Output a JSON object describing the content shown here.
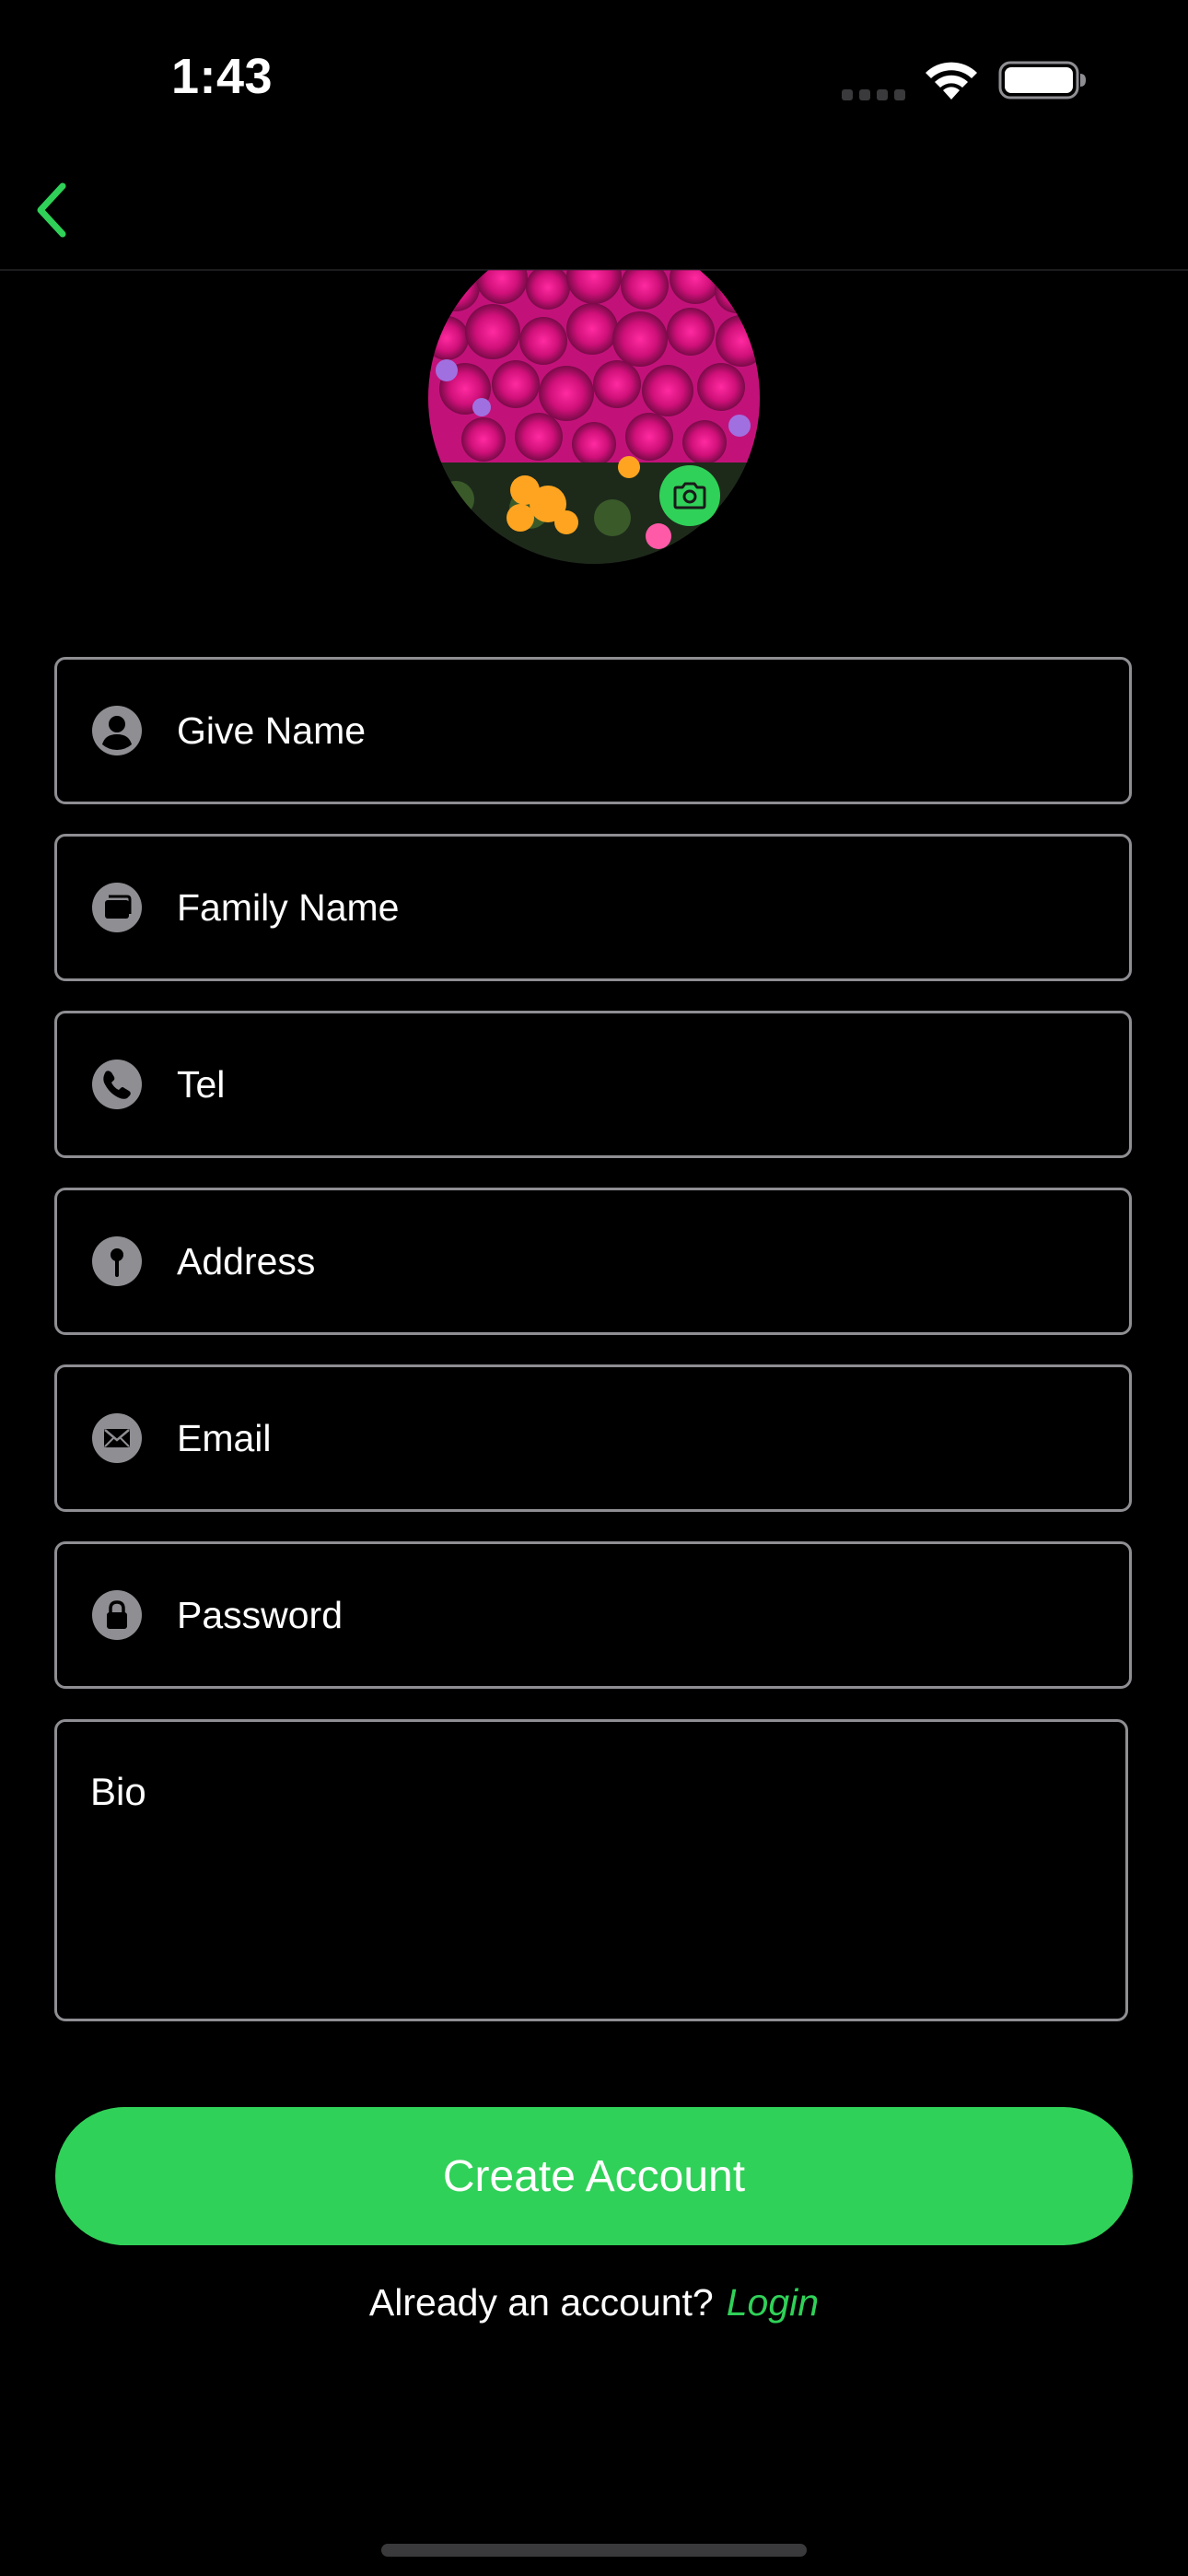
{
  "status_bar": {
    "time": "1:43"
  },
  "nav": {
    "back_icon": "chevron-left-icon"
  },
  "profile": {
    "avatar_icon": "photo-avatar",
    "camera_icon": "camera-icon"
  },
  "form": {
    "fields": [
      {
        "placeholder": "Give Name",
        "icon": "person-icon"
      },
      {
        "placeholder": "Family Name",
        "icon": "family-icon"
      },
      {
        "placeholder": "Tel",
        "icon": "phone-icon"
      },
      {
        "placeholder": "Address",
        "icon": "location-icon"
      },
      {
        "placeholder": "Email",
        "icon": "envelope-icon"
      },
      {
        "placeholder": "Password",
        "icon": "lock-icon"
      }
    ],
    "bio_placeholder": "Bio"
  },
  "actions": {
    "create_account_label": "Create Account",
    "login_prompt": "Already an account?",
    "login_link": "Login"
  },
  "colors": {
    "accent": "#30d158",
    "background": "#000000",
    "field_border": "#8e8e93",
    "icon_fill": "#8e8e93"
  }
}
